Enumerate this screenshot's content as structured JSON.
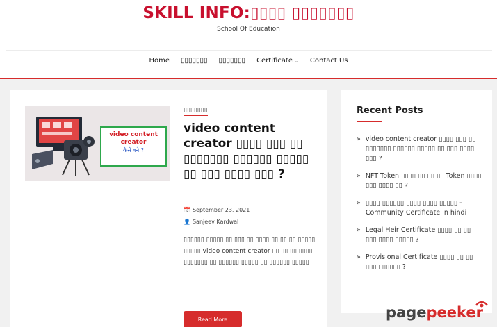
{
  "header": {
    "site_title": "SKILL INFO:▯▯▯▯ ▯▯▯▯▯▯▯",
    "tagline": "School Of Education"
  },
  "nav": {
    "items": [
      {
        "label": "Home"
      },
      {
        "label": "▯▯▯▯▯▯▯"
      },
      {
        "label": "▯▯▯▯▯▯▯"
      },
      {
        "label": "Certificate",
        "has_dropdown": true
      },
      {
        "label": "Contact Us"
      }
    ]
  },
  "post": {
    "thumbnail": {
      "line1": "video content",
      "line2": "creator",
      "line3": "कैसे बने ?"
    },
    "category": "▯▯▯▯▯▯▯",
    "title": "video content creator ▯▯▯▯ ▯▯▯ ▯▯ ▯▯▯▯▯▯▯ ▯▯▯▯▯▯ ▯▯▯▯▯ ▯▯ ▯▯▯ ▯▯▯▯ ▯▯▯ ?",
    "date": "September 23, 2021",
    "author": "Sanjeev Kardwal",
    "excerpt": "▯▯▯▯▯▯ ▯▯▯▯▯ ▯▯ ▯▯▯ ▯▯ ▯▯▯▯ ▯▯ ▯▯ ▯▯ ▯▯▯▯▯ ▯▯▯▯▯ video content creator ▯▯ ▯▯ ▯▯ ▯▯▯▯ ▯▯▯▯▯▯▯ ▯▯ ▯▯▯▯▯▯ ▯▯▯▯▯ ▯▯ ▯▯▯▯▯▯ ▯▯▯▯▯",
    "read_more": "Read More"
  },
  "sidebar": {
    "title": "Recent Posts",
    "items": [
      "video content creator ▯▯▯▯ ▯▯▯ ▯▯ ▯▯▯▯▯▯▯ ▯▯▯▯▯▯ ▯▯▯▯▯ ▯▯ ▯▯▯ ▯▯▯▯ ▯▯▯ ?",
      "NFT Token ▯▯▯▯ ▯▯ ▯▯ ▯▯ Token ▯▯▯▯ ▯▯▯ ▯▯▯▯ ▯▯ ?",
      "▯▯▯▯ ▯▯▯▯▯▯ ▯▯▯▯ ▯▯▯▯ ▯▯▯▯▯ -Community Certificate in hindi",
      "Legal Heir Certificate ▯▯▯▯ ▯▯ ▯▯ ▯▯▯ ▯▯▯▯ ▯▯▯▯▯ ?",
      "Provisional Certificate ▯▯▯▯ ▯▯ ▯▯ ▯▯▯▯ ▯▯▯▯▯ ?"
    ]
  },
  "watermark": {
    "part1": "page",
    "part2": "peeker"
  }
}
